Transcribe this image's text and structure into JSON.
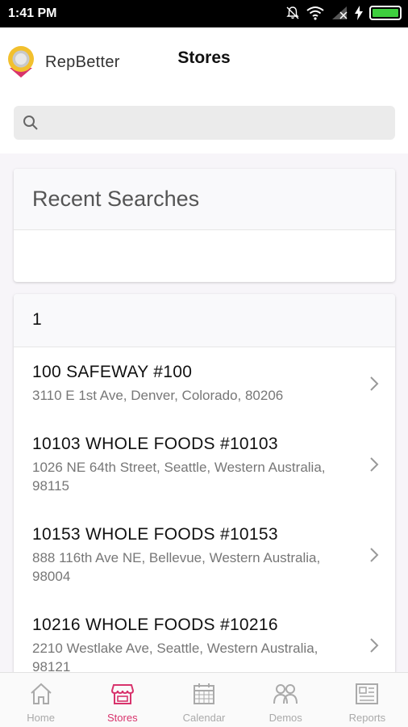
{
  "status_bar": {
    "time": "1:41 PM"
  },
  "header": {
    "brand": "RepBetter",
    "title": "Stores"
  },
  "search": {
    "placeholder": "",
    "value": ""
  },
  "recent_searches": {
    "title": "Recent Searches",
    "items": []
  },
  "results": {
    "group_label": "1",
    "stores": [
      {
        "name": "100 SAFEWAY #100",
        "address": "3110 E 1st Ave, Denver, Colorado, 80206"
      },
      {
        "name": "10103 WHOLE FOODS #10103",
        "address": "1026 NE 64th Street, Seattle, Western Australia, 98115"
      },
      {
        "name": "10153 WHOLE FOODS #10153",
        "address": "888 116th Ave NE, Bellevue, Western Australia, 98004"
      },
      {
        "name": "10216 WHOLE FOODS #10216",
        "address": "2210 Westlake Ave, Seattle, Western Australia, 98121"
      }
    ]
  },
  "tabs": [
    {
      "label": "Home",
      "icon": "home-icon"
    },
    {
      "label": "Stores",
      "icon": "store-icon",
      "active": true
    },
    {
      "label": "Calendar",
      "icon": "calendar-icon"
    },
    {
      "label": "Demos",
      "icon": "demos-icon"
    },
    {
      "label": "Reports",
      "icon": "reports-icon"
    }
  ],
  "colors": {
    "accent": "#d8336c",
    "inactive_tab": "#aaaaaa",
    "battery": "#3ecf3e"
  }
}
